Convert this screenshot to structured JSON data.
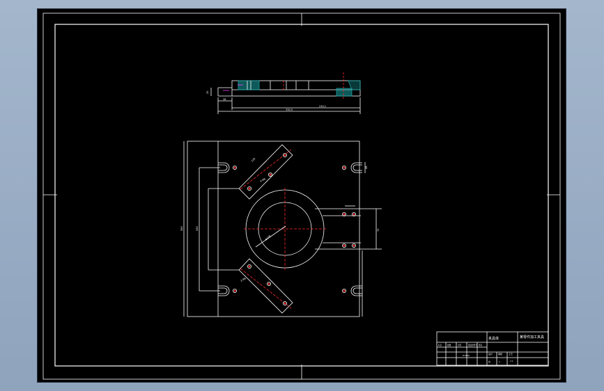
{
  "colors": {
    "outline": "#ffffff",
    "centerline": "#ff2a2a",
    "hatch": "#1aa3a3",
    "dimension": "#ffffff",
    "highlight": "#ff3cff"
  },
  "title_block": {
    "part_name": "夹具体",
    "drawing_title": "某零件加工夹具",
    "scale": "1:1",
    "material": "HT200",
    "sheet": "1",
    "labels": [
      "标记",
      "处数",
      "分区",
      "更改文件号",
      "签名",
      "年月日",
      "设计",
      "审核",
      "工艺",
      "阶段标记",
      "重量",
      "比例",
      "共",
      "张",
      "第"
    ]
  },
  "dimensions": {
    "side_view_total": "330.5",
    "side_view_center": "230.1",
    "side_view_height": "20",
    "side_view_step": "38",
    "plan_overall_height": "380",
    "plan_inner_height": "280",
    "plan_slot_width": "48",
    "plan_arm_length": "120",
    "plan_bore_dia": "Φ160",
    "plan_tab_width": "70",
    "hole_note_1": "4-Φ8",
    "hole_note_2": "2-Φ8"
  }
}
